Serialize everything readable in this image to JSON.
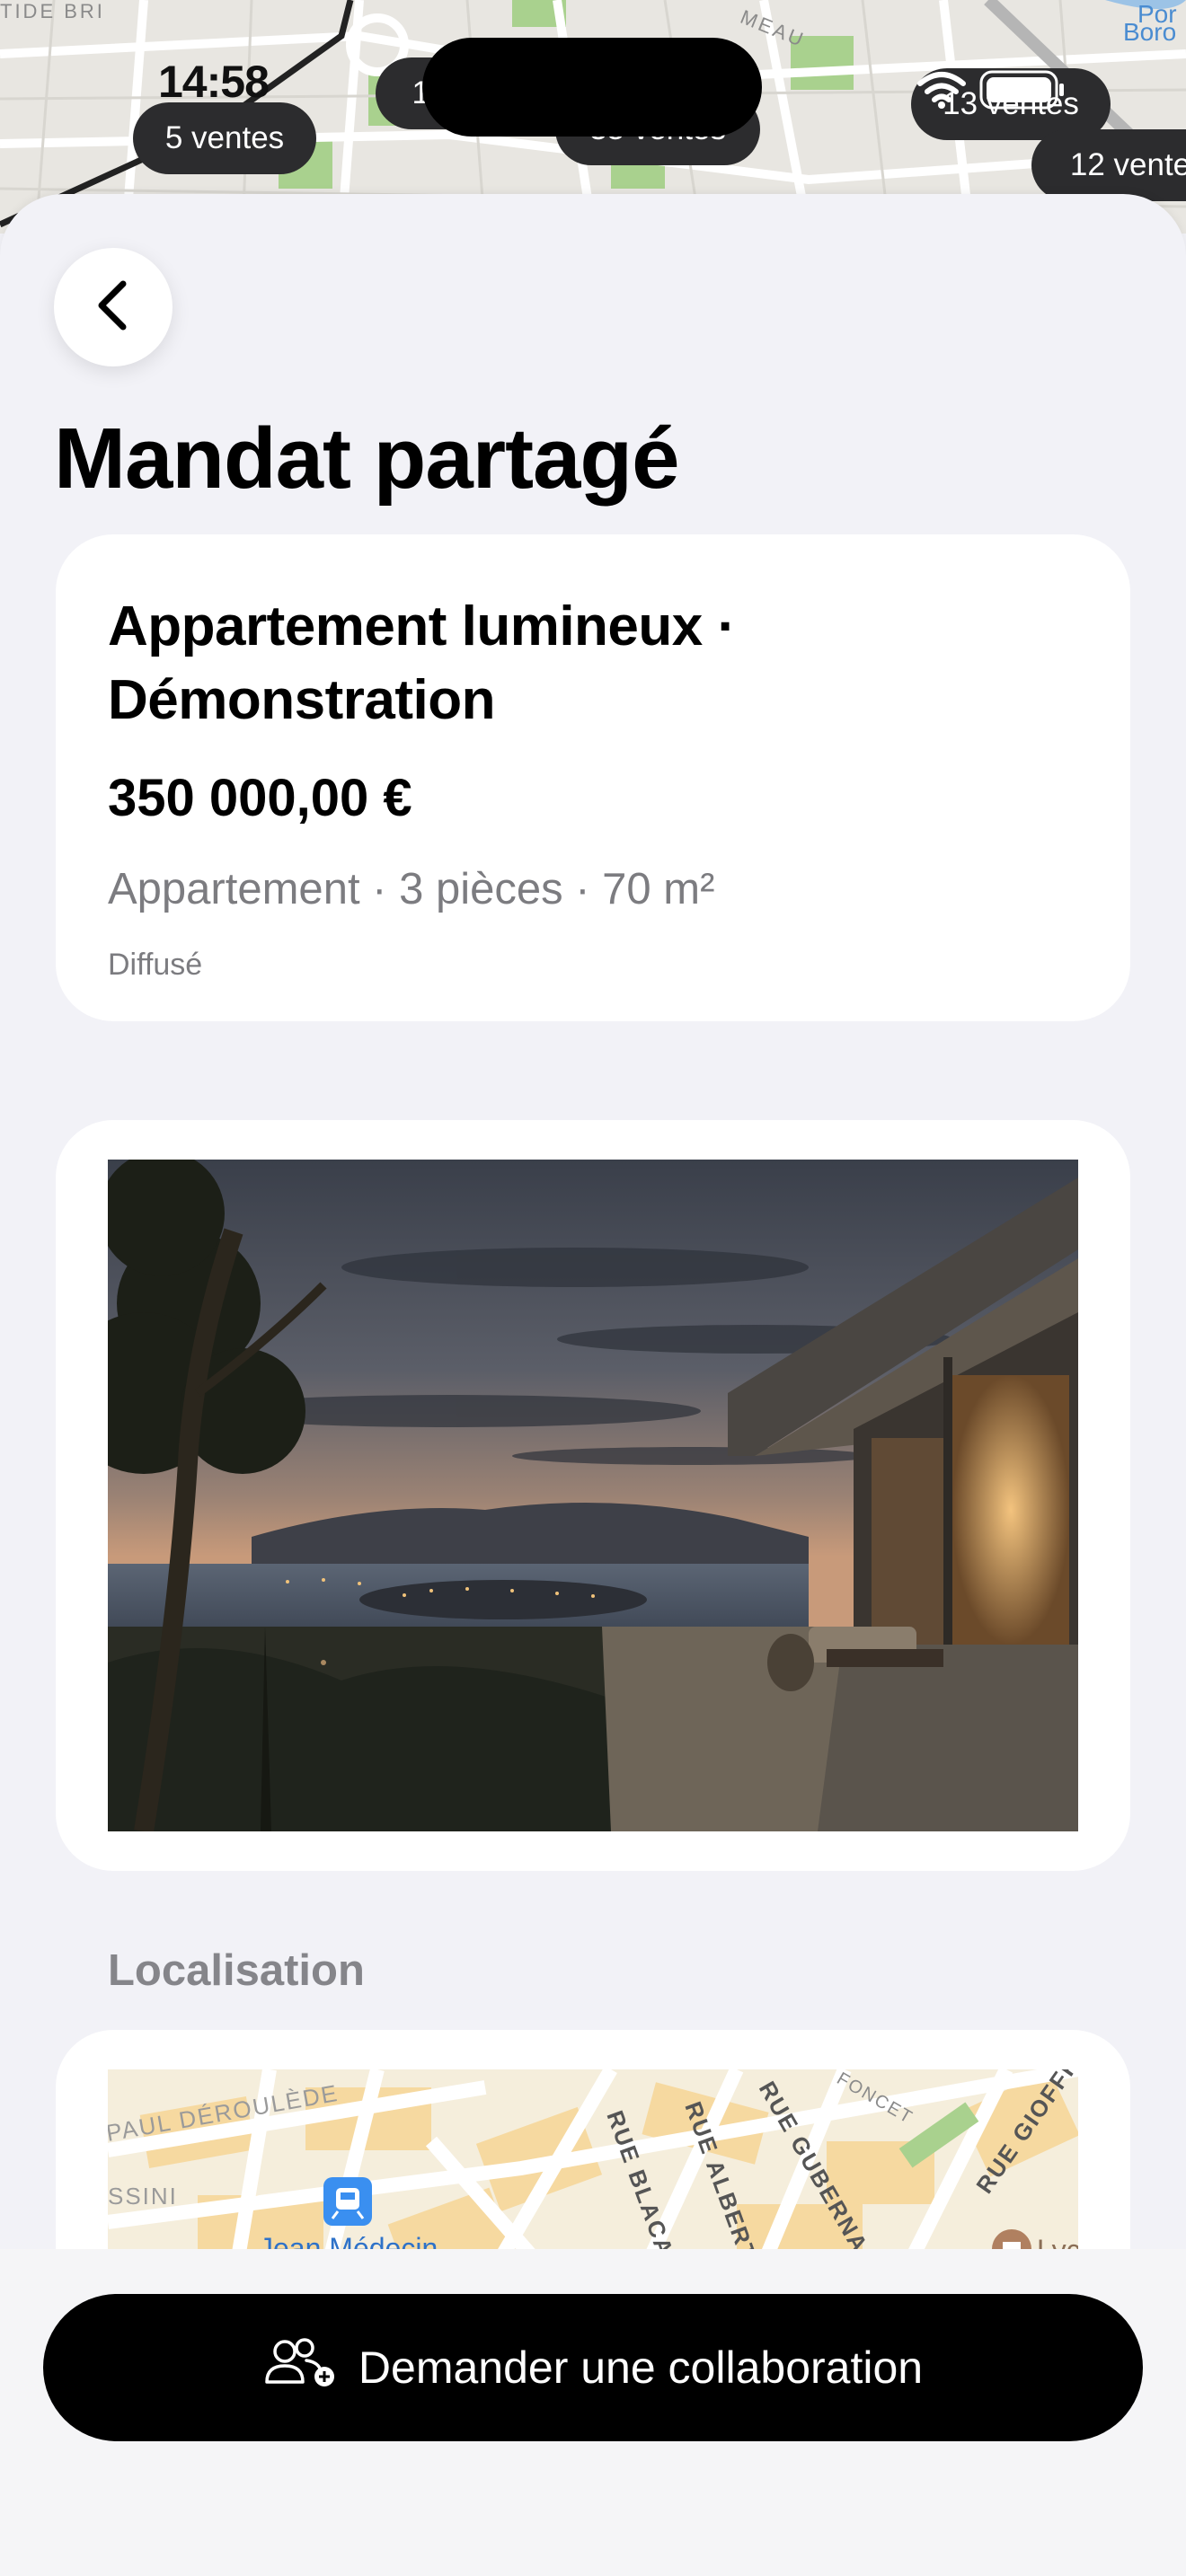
{
  "status_bar": {
    "time": "14:58"
  },
  "background_map": {
    "badges": [
      {
        "label": "5 ventes"
      },
      {
        "label": "16"
      },
      {
        "label": "35 ventes"
      },
      {
        "label": "13 ventes"
      },
      {
        "label": "12 vente"
      }
    ],
    "labels": [
      "TIDE BRI",
      "MEAU",
      "Por",
      "Boro"
    ]
  },
  "header": {
    "title": "Mandat partagé",
    "back_icon": "chevron-left-icon"
  },
  "listing": {
    "title": "Appartement lumineux · Démonstration",
    "price": "350 000,00 €",
    "details": "Appartement · 3 pièces · 70 m²",
    "status": "Diffusé"
  },
  "photo": {
    "description_icon": "listing-photo"
  },
  "location": {
    "section_label": "Localisation",
    "street_labels": [
      "PAUL DÉROULÈDE",
      "SSINI",
      "RUE BLACA",
      "RUE ALBERT",
      "RUE GUBERNA",
      "FONCET",
      "RUE GIOFFR"
    ],
    "station_label": "Jean Médecin",
    "poi_label": "Lyc",
    "transit_icon": "tram-icon",
    "poi_icon": "school-icon"
  },
  "action": {
    "label": "Demander une collaboration",
    "icon": "add-user-icon"
  },
  "colors": {
    "background": "#f2f2f7",
    "card": "#ffffff",
    "button": "#000000",
    "secondary_text": "#7c7c80",
    "map_park": "#a9d18e",
    "transit_blue": "#3a8ff0"
  }
}
